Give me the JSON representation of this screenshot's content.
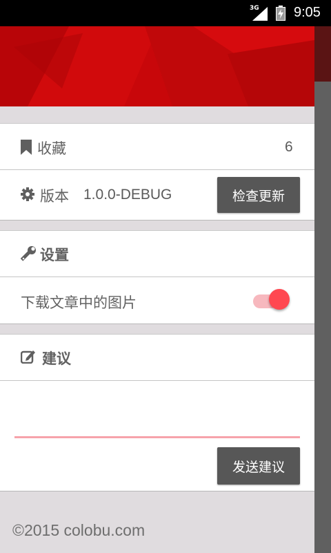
{
  "status_bar": {
    "network": "3G",
    "time": "9:05"
  },
  "drawer": {
    "favorites": {
      "label": "收藏",
      "count": "6"
    },
    "version": {
      "label": "版本",
      "value": "1.0.0-DEBUG",
      "button_label": "检查更新"
    },
    "settings": {
      "title": "设置",
      "download_images_label": "下载文章中的图片",
      "download_images_enabled": true
    },
    "suggestion": {
      "title": "建议",
      "input_value": "",
      "send_button_label": "发送建议"
    },
    "footer": {
      "text": "©2015  colobu.com"
    }
  },
  "colors": {
    "header_red": "#c8070a",
    "accent_pink": "#ff4851",
    "button_gray": "#575757"
  }
}
